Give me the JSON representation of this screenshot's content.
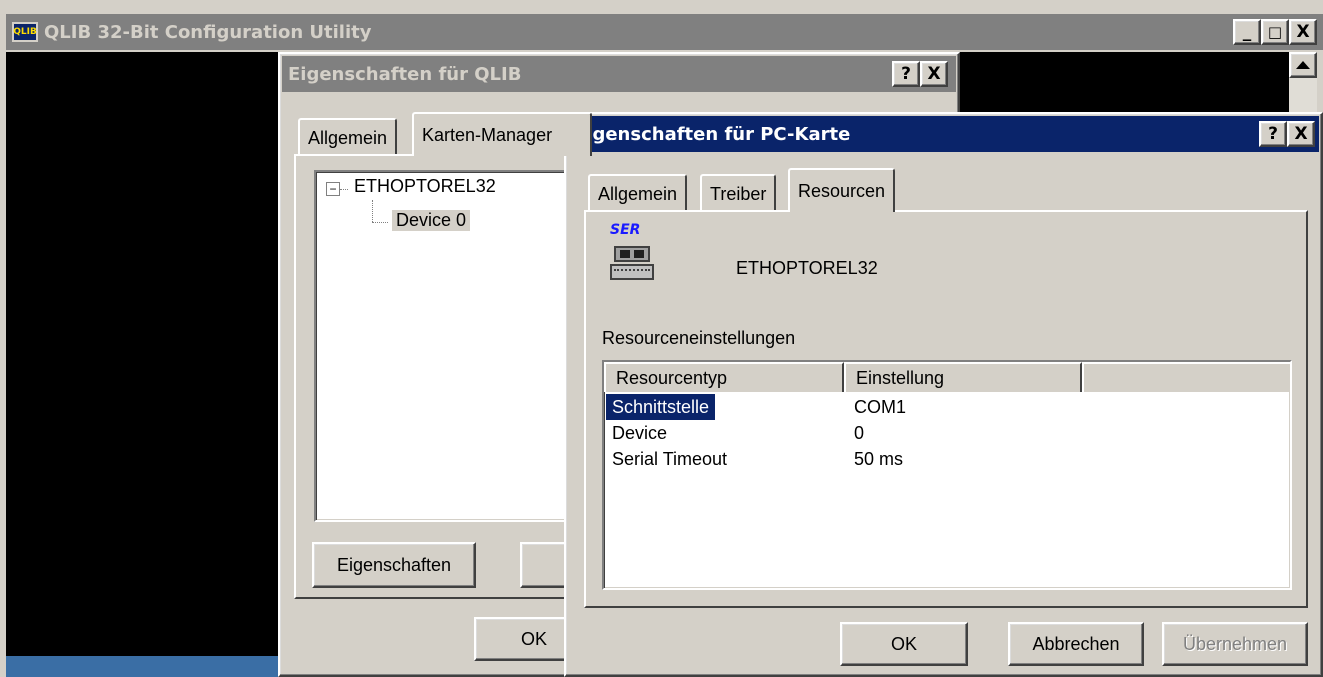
{
  "main_window": {
    "title": "QLIB 32-Bit Configuration Utility",
    "app_icon_text": "QLIB",
    "caption_buttons": [
      "_",
      "□",
      "X"
    ]
  },
  "qlib_dialog": {
    "title": "Eigenschaften für QLIB",
    "help_button": "?",
    "close_button": "X",
    "tabs": [
      "Allgemein",
      "Karten-Manager"
    ],
    "tree": {
      "root": "ETHOPTOREL32",
      "root_expander": "−",
      "child": "Device 0"
    },
    "properties_button": "Eigenschaften",
    "ok_button": "OK"
  },
  "pc_card_dialog": {
    "title": "Eigenschaften für PC-Karte",
    "help_button": "?",
    "close_button": "X",
    "tabs": [
      "Allgemein",
      "Treiber",
      "Resourcen"
    ],
    "selected_tab": "Resourcen",
    "device_icon_label": "SER",
    "device_name": "ETHOPTOREL32",
    "resource_settings_label": "Resourceneinstellungen",
    "columns": [
      "Resourcentyp",
      "Einstellung",
      ""
    ],
    "rows": [
      {
        "type": "Schnittstelle",
        "value": "COM1",
        "selected": true
      },
      {
        "type": "Device",
        "value": "0",
        "selected": false
      },
      {
        "type": "Serial Timeout",
        "value": "50 ms",
        "selected": false
      }
    ],
    "ok_button": "OK",
    "cancel_button": "Abbrechen",
    "apply_button": "Übernehmen"
  },
  "colors": {
    "active_title": "#0a246a",
    "inactive_title": "#808080",
    "face": "#d4d0c8",
    "selection": "#0a246a"
  }
}
